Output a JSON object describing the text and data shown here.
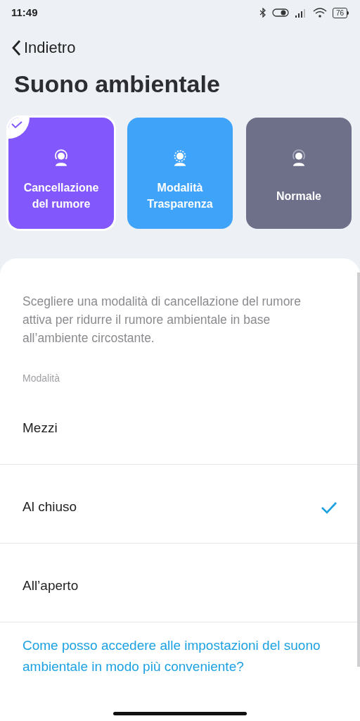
{
  "status_bar": {
    "time": "11:49",
    "battery": "76"
  },
  "back_link": {
    "label": "Indietro"
  },
  "title": "Suono ambientale",
  "modes": [
    {
      "label": "Cancellazione del rumore",
      "selected": true,
      "color": "#8257fb",
      "kind": "anc"
    },
    {
      "label": "Modalità Trasparenza",
      "selected": false,
      "color": "#40a3fa",
      "kind": "transparency"
    },
    {
      "label": "Normale",
      "selected": false,
      "color": "#6e7089",
      "kind": "normal"
    }
  ],
  "description": "Scegliere una modalità di cancellazione del rumore attiva per ridurre il rumore ambientale in base all’ambiente circostante.",
  "section_label": "Modalità",
  "options": [
    {
      "label": "Mezzi",
      "selected": false
    },
    {
      "label": "Al chiuso",
      "selected": true
    },
    {
      "label": "All’aperto",
      "selected": false
    }
  ],
  "help_link": "Come posso accedere alle impostazioni del suono ambientale in modo più conveniente?"
}
